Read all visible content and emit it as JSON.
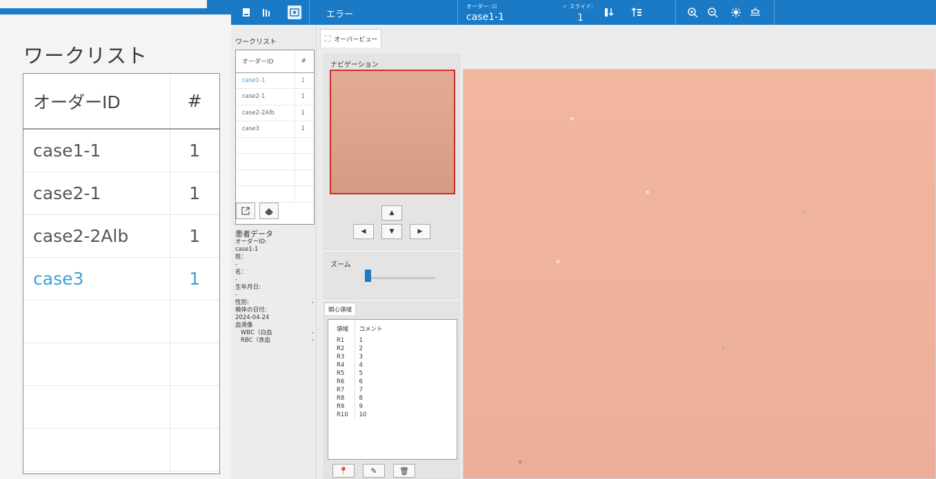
{
  "zoom_panel": {
    "title": "ワークリスト",
    "columns": [
      "オーダーID",
      "#"
    ],
    "rows": [
      {
        "id": "case1-1",
        "count": "1"
      },
      {
        "id": "case2-1",
        "count": "1"
      },
      {
        "id": "case2-2Alb",
        "count": "1"
      },
      {
        "id": "case3",
        "count": "1"
      }
    ]
  },
  "toolbar": {
    "error_label": "エラー",
    "order_small": "オーダー: ☑",
    "order_value": "case1-1",
    "slide_small": "✓ スライド:",
    "slide_value": "1",
    "icons": [
      "worklist-icon",
      "slides-icon",
      "eye-icon",
      "sort-icon",
      "filter-icon",
      "zoom-in-icon",
      "zoom-out-icon",
      "brightness-up-icon",
      "brightness-down-icon"
    ]
  },
  "worklist": {
    "label": "ワークリスト",
    "columns": [
      "オーダーID",
      "#"
    ],
    "rows": [
      {
        "id": "case1-1",
        "count": "1"
      },
      {
        "id": "case2-1",
        "count": "1"
      },
      {
        "id": "case2-2Alb",
        "count": "1"
      },
      {
        "id": "case3",
        "count": "1"
      }
    ]
  },
  "patient": {
    "heading": "患者データ",
    "order_id_label": "オーダーID:",
    "order_id": "case1-1",
    "last_name_label": "姓：",
    "last_name": "-",
    "first_name_label": "名：",
    "first_name": "-",
    "birth_label": "生年月日:",
    "birth": "-",
    "sex_label": "性別:",
    "sex": "-",
    "sample_date_label": "検体の日付:",
    "sample_date": "2024-04-24",
    "blood_label": "血液像",
    "wbc_label": "WBC（白血",
    "wbc": "-",
    "rbc_label": "RBC（赤血",
    "rbc": "-"
  },
  "overview": {
    "tab_label": "オーバービュー",
    "nav_label": "ナビゲーション",
    "zoom_label": "ズーム",
    "zoom_level": 0.05,
    "roi_tab": "関心領域",
    "roi_columns": [
      "領域",
      "コメント"
    ],
    "roi_rows": [
      [
        "R1",
        "1"
      ],
      [
        "R2",
        "2"
      ],
      [
        "R3",
        "3"
      ],
      [
        "R4",
        "4"
      ],
      [
        "R5",
        "5"
      ],
      [
        "R6",
        "6"
      ],
      [
        "R7",
        "7"
      ],
      [
        "R8",
        "8"
      ],
      [
        "R9",
        "9"
      ],
      [
        "R10",
        "10"
      ]
    ]
  },
  "colors": {
    "accent": "#1a7ac6",
    "selected_text": "#3aa0d6",
    "nav_frame": "#cc2a2a",
    "tissue": "#efb29b"
  }
}
